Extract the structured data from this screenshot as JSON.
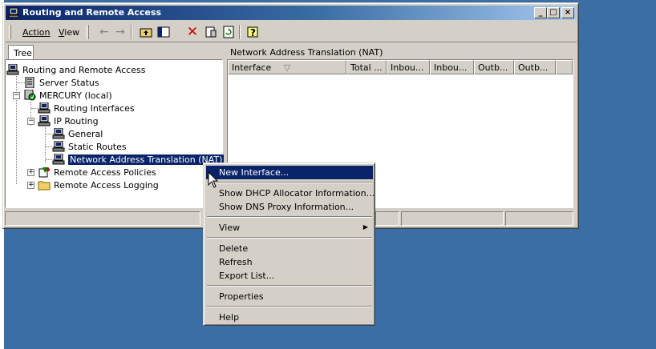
{
  "window": {
    "title": "Routing and Remote Access",
    "caption_buttons": {
      "minimize": "_",
      "maximize": "□",
      "close": "×"
    }
  },
  "toolbar": {
    "menu_action": "Action",
    "menu_view": "View",
    "icons": [
      "back-arrow-icon",
      "forward-arrow-icon",
      "up-folder-icon",
      "show-hide-tree-icon",
      "delete-icon",
      "properties-icon",
      "refresh-icon",
      "help-icon"
    ]
  },
  "tree": {
    "tab_label": "Tree",
    "root": "Routing and Remote Access",
    "items": [
      {
        "label": "Server Status"
      },
      {
        "label": "MERCURY (local)"
      },
      {
        "label": "Routing Interfaces"
      },
      {
        "label": "IP Routing"
      },
      {
        "label": "General"
      },
      {
        "label": "Static Routes"
      },
      {
        "label": "Network Address Translation (NAT)"
      },
      {
        "label": "Remote Access Policies"
      },
      {
        "label": "Remote Access Logging"
      }
    ]
  },
  "details": {
    "title": "Network Address Translation (NAT)",
    "columns": [
      "Interface",
      "Total ...",
      "Inbou...",
      "Inbou...",
      "Outb...",
      "Outb..."
    ],
    "sort_indicator": "▽"
  },
  "context_menu": {
    "items": [
      {
        "label": "New Interface...",
        "highlighted": true
      },
      {
        "label": "Show DHCP Allocator Information..."
      },
      {
        "label": "Show DNS Proxy Information..."
      },
      {
        "label": "View",
        "submenu": "▶"
      },
      {
        "label": "Delete"
      },
      {
        "label": "Refresh"
      },
      {
        "label": "Export List..."
      },
      {
        "label": "Properties"
      },
      {
        "label": "Help"
      }
    ]
  },
  "colors": {
    "title_active": "#0a246a",
    "face": "#d4d0c8",
    "desktop": "#3a6ea5",
    "selection": "#0a246a",
    "delete_red": "#cc0000"
  }
}
